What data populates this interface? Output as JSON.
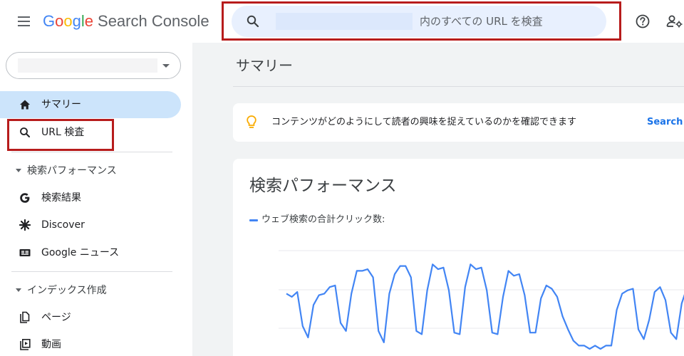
{
  "header": {
    "logo": {
      "g1": "G",
      "g2": "o",
      "g3": "o",
      "g4": "g",
      "g5": "l",
      "g6": "e",
      "product": "Search Console"
    },
    "search": {
      "text": "内のすべての URL を検査"
    }
  },
  "sidebar": {
    "items": [
      {
        "label": "サマリー"
      },
      {
        "label": "URL 検査"
      }
    ],
    "performance_section": {
      "label": "検索パフォーマンス",
      "items": [
        {
          "label": "検索結果"
        },
        {
          "label": "Discover"
        },
        {
          "label": "Google ニュース"
        }
      ]
    },
    "index_section": {
      "label": "インデックス作成",
      "items": [
        {
          "label": "ページ"
        },
        {
          "label": "動画"
        }
      ]
    }
  },
  "main": {
    "title": "サマリー",
    "tip": {
      "text": "コンテンツがどのようにして読者の興味を捉えているのかを確認できます",
      "link": "Search C"
    },
    "performance": {
      "title": "検索パフォーマンス",
      "legend": "ウェブ検索の合計クリック数:"
    }
  },
  "colors": {
    "accent": "#4285f4",
    "active_nav": "#cce4fb",
    "highlight_box": "#b71c1c",
    "link": "#1a73e8"
  },
  "chart_data": {
    "type": "line",
    "series": [
      {
        "name": "ウェブ検索の合計クリック数:",
        "values": [
          34,
          32,
          35,
          14,
          7,
          27,
          33,
          34,
          38,
          39,
          16,
          11,
          34,
          48,
          48,
          49,
          44,
          11,
          4,
          34,
          46,
          51,
          51,
          44,
          11,
          9,
          36,
          52,
          49,
          50,
          36,
          10,
          9,
          38,
          52,
          49,
          50,
          36,
          10,
          9,
          32,
          48,
          45,
          46,
          33,
          10,
          10,
          31,
          39,
          37,
          32,
          20,
          12,
          5,
          2,
          2,
          0,
          2,
          0,
          2,
          2,
          24,
          34,
          36,
          37,
          12,
          6,
          18,
          35,
          38,
          30,
          10,
          6,
          28,
          38
        ]
      }
    ],
    "ylim": [
      0,
      60
    ],
    "grid": true
  }
}
